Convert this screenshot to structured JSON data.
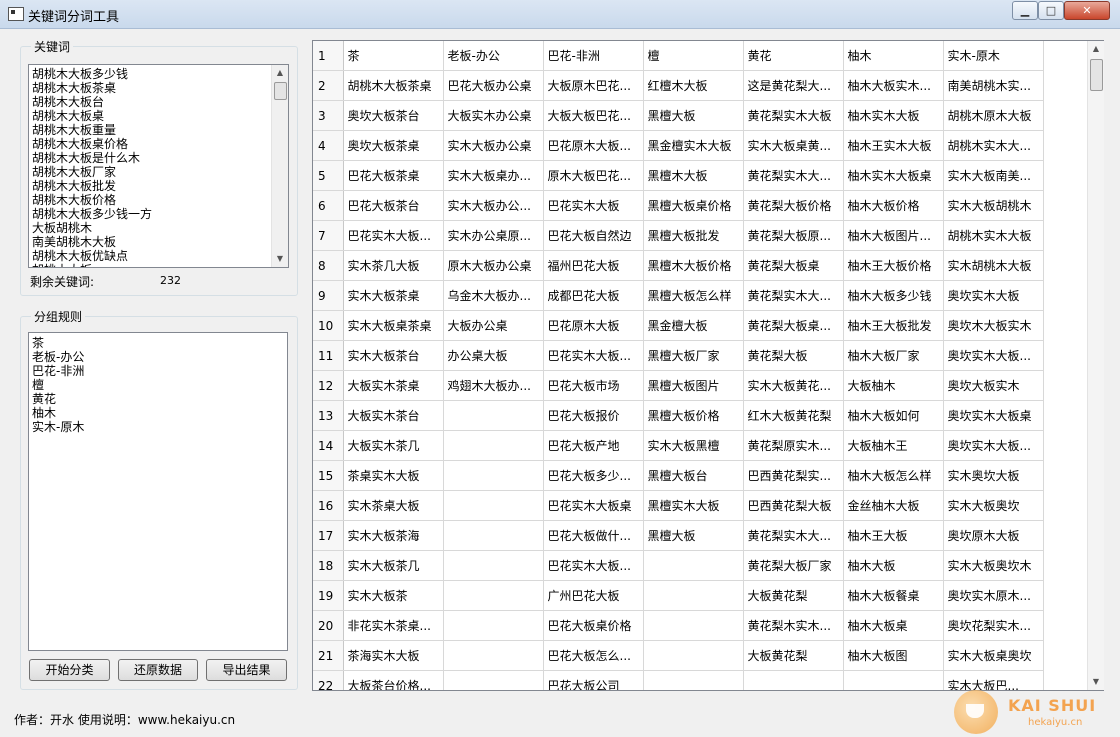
{
  "window": {
    "title": "关键词分词工具",
    "min_glyph": "▁",
    "max_glyph": "□",
    "close_glyph": "✕"
  },
  "keywords_panel": {
    "title": "关键词",
    "items": [
      "胡桃木大板多少钱",
      "胡桃木大板茶桌",
      "胡桃木大板台",
      "胡桃木大板桌",
      "胡桃木大板重量",
      "胡桃木大板桌价格",
      "胡桃木大板是什么木",
      "胡桃木大板厂家",
      "胡桃木大板批发",
      "胡桃木大板价格",
      "胡桃木大板多少钱一方",
      "大板胡桃木",
      "南美胡桃木大板",
      "胡桃木大板优缺点",
      "胡桃木大板"
    ],
    "remaining_label": "剩余关键词:",
    "remaining_count": "232"
  },
  "rules_panel": {
    "title": "分组规则",
    "rules": [
      "茶",
      "老板-办公",
      "巴花-非洲",
      "檀",
      "黄花",
      "柚木",
      "实木-原木"
    ]
  },
  "buttons": {
    "start": "开始分类",
    "restore": "还原数据",
    "export": "导出结果"
  },
  "footer": "作者：开水  使用说明：www.hekaiyu.cn",
  "table": {
    "columns": [
      "茶",
      "老板-办公",
      "巴花-非洲",
      "檀",
      "黄花",
      "柚木",
      "实木-原木"
    ],
    "rows": [
      {
        "n": "2",
        "cells": [
          "胡桃木大板茶桌",
          "巴花大板办公桌",
          "大板原木巴花...",
          "红檀木大板",
          "这是黄花梨大...",
          "柚木大板实木...",
          "南美胡桃木实..."
        ]
      },
      {
        "n": "3",
        "cells": [
          "奥坎大板茶台",
          "大板实木办公桌",
          "大板大板巴花...",
          "黑檀大板",
          "黄花梨实木大板",
          "柚木实木大板",
          "胡桃木原木大板"
        ]
      },
      {
        "n": "4",
        "cells": [
          "奥坎大板茶桌",
          "实木大板办公桌",
          "巴花原木大板...",
          "黑金檀实木大板",
          "实木大板桌黄...",
          "柚木王实木大板",
          "胡桃木实木大..."
        ]
      },
      {
        "n": "5",
        "cells": [
          "巴花大板茶桌",
          "实木大板桌办...",
          "原木大板巴花...",
          "黑檀木大板",
          "黄花梨实木大...",
          "柚木实木大板桌",
          "实木大板南美..."
        ]
      },
      {
        "n": "6",
        "cells": [
          "巴花大板茶台",
          "实木大板办公...",
          "巴花实木大板",
          "黑檀大板桌价格",
          "黄花梨大板价格",
          "柚木大板价格",
          "实木大板胡桃木"
        ]
      },
      {
        "n": "7",
        "cells": [
          "巴花实木大板...",
          "实木办公桌原...",
          "巴花大板自然边",
          "黑檀大板批发",
          "黄花梨大板原...",
          "柚木大板图片...",
          "胡桃木实木大板"
        ]
      },
      {
        "n": "8",
        "cells": [
          "实木茶几大板",
          "原木大板办公桌",
          "福州巴花大板",
          "黑檀木大板价格",
          "黄花梨大板桌",
          "柚木王大板价格",
          "实木胡桃木大板"
        ]
      },
      {
        "n": "9",
        "cells": [
          "实木大板茶桌",
          "乌金木大板办...",
          "成都巴花大板",
          "黑檀大板怎么样",
          "黄花梨实木大...",
          "柚木大板多少钱",
          "奥坎实木大板"
        ]
      },
      {
        "n": "10",
        "cells": [
          "实木大板桌茶桌",
          "大板办公桌",
          "巴花原木大板",
          "黑金檀大板",
          "黄花梨大板桌...",
          "柚木王大板批发",
          "奥坎木大板实木"
        ]
      },
      {
        "n": "11",
        "cells": [
          "实木大板茶台",
          "办公桌大板",
          "巴花实木大板...",
          "黑檀大板厂家",
          "黄花梨大板",
          "柚木大板厂家",
          "奥坎实木大板..."
        ]
      },
      {
        "n": "12",
        "cells": [
          "大板实木茶桌",
          "鸡翅木大板办...",
          "巴花大板市场",
          "黑檀大板图片",
          "实木大板黄花...",
          "大板柚木",
          "奥坎大板实木"
        ]
      },
      {
        "n": "13",
        "cells": [
          "大板实木茶台",
          "",
          "巴花大板报价",
          "黑檀大板价格",
          "红木大板黄花梨",
          "柚木大板如何",
          "奥坎实木大板桌"
        ]
      },
      {
        "n": "14",
        "cells": [
          "大板实木茶几",
          "",
          "巴花大板产地",
          "实木大板黑檀",
          "黄花梨原实木...",
          "大板柚木王",
          "奥坎实木大板..."
        ]
      },
      {
        "n": "15",
        "cells": [
          "茶桌实木大板",
          "",
          "巴花大板多少...",
          "黑檀大板台",
          "巴西黄花梨实...",
          "柚木大板怎么样",
          "实木奥坎大板"
        ]
      },
      {
        "n": "16",
        "cells": [
          "实木茶桌大板",
          "",
          "巴花实木大板桌",
          "黑檀实木大板",
          "巴西黄花梨大板",
          "金丝柚木大板",
          "实木大板奥坎"
        ]
      },
      {
        "n": "17",
        "cells": [
          "实木大板茶海",
          "",
          "巴花大板做什...",
          "黑檀大板",
          "黄花梨实木大...",
          "柚木王大板",
          "奥坎原木大板"
        ]
      },
      {
        "n": "18",
        "cells": [
          "实木大板茶几",
          "",
          "巴花实木大板...",
          "",
          "黄花梨大板厂家",
          "柚木大板",
          "实木大板奥坎木"
        ]
      },
      {
        "n": "19",
        "cells": [
          "实木大板茶",
          "",
          "广州巴花大板",
          "",
          "大板黄花梨",
          "柚木大板餐桌",
          "奥坎实木原木..."
        ]
      },
      {
        "n": "20",
        "cells": [
          "非花实木茶桌...",
          "",
          "巴花大板桌价格",
          "",
          "黄花梨木实木...",
          "柚木大板桌",
          "奥坎花梨实木..."
        ]
      },
      {
        "n": "21",
        "cells": [
          "茶海实木大板",
          "",
          "巴花大板怎么...",
          "",
          "大板黄花梨",
          "柚木大板图",
          "实木大板桌奥坎"
        ]
      },
      {
        "n": "22",
        "cells": [
          "大板茶台价格...",
          "",
          "巴花大板公司",
          "",
          "",
          "",
          "实木大板巴..."
        ]
      }
    ]
  },
  "logo": {
    "title": "KAI SHUI",
    "subtitle": "hekaiyu.cn"
  }
}
